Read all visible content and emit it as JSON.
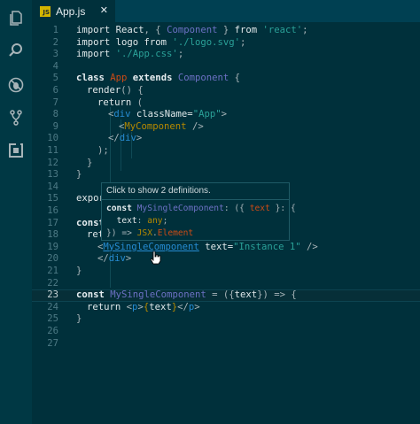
{
  "activity_bar": {
    "items": [
      {
        "name": "explorer-icon"
      },
      {
        "name": "search-icon"
      },
      {
        "name": "debug-icon"
      },
      {
        "name": "source-control-icon"
      },
      {
        "name": "extensions-icon"
      }
    ]
  },
  "tab": {
    "badge": "JS",
    "title": "App.js",
    "close": "✕"
  },
  "code": {
    "line_numbers": [
      "1",
      "2",
      "3",
      "4",
      "5",
      "6",
      "7",
      "8",
      "9",
      "10",
      "11",
      "12",
      "13",
      "14",
      "15",
      "16",
      "17",
      "18",
      "19",
      "20",
      "21",
      "22",
      "23",
      "24",
      "25",
      "26",
      "27"
    ],
    "current_line": "23",
    "l1": [
      "import ",
      "React",
      ", { ",
      "Component",
      " } ",
      "from",
      " ",
      "'react'",
      ";"
    ],
    "l2": [
      "import logo from ",
      "'./logo.svg'",
      ";"
    ],
    "l3": [
      "import ",
      "'./App.css'",
      ";"
    ],
    "l5": [
      "class ",
      "App",
      " extends ",
      "Component",
      " {"
    ],
    "l6": [
      "render",
      "() {"
    ],
    "l7": [
      "return",
      " ("
    ],
    "l8": [
      "<",
      "div",
      " className=",
      "\"App\"",
      ">"
    ],
    "l9": [
      "<",
      "MyComponent",
      " />"
    ],
    "l10": [
      "</",
      "div",
      ">"
    ],
    "l11": [
      ");"
    ],
    "l12": [
      "}"
    ],
    "l13": [
      "}"
    ],
    "l15": [
      "expor"
    ],
    "l17": [
      "const"
    ],
    "l18": [
      "ret"
    ],
    "l19": [
      "<",
      "MySingleComponent",
      " text=",
      "\"Instance 1\"",
      " />"
    ],
    "l20": [
      "</",
      "div",
      ">"
    ],
    "l21": [
      "}"
    ],
    "l23": [
      "const ",
      "MySingleComponent",
      " = ({",
      "text",
      "}) => {"
    ],
    "l24": [
      "return ",
      "<",
      "p",
      ">",
      "{",
      "text",
      "}",
      "</",
      "p",
      ">"
    ],
    "l25": [
      "}"
    ]
  },
  "hover": {
    "header": "Click to show 2 definitions.",
    "line1": [
      "const ",
      "MySingleComponent",
      ": ({ ",
      "text",
      " }: {"
    ],
    "line2": [
      "text",
      ": ",
      "any",
      ";"
    ],
    "line3": [
      "}) => ",
      "JSX",
      ".",
      "Element"
    ]
  },
  "colors": {
    "background": "#00303b",
    "keyword": "#e0e8ea",
    "string": "#2aa198",
    "class_name": "#cb4b16",
    "type": "#6c71c4",
    "tag": "#268bd2",
    "jsx_expression": "#b58900"
  }
}
